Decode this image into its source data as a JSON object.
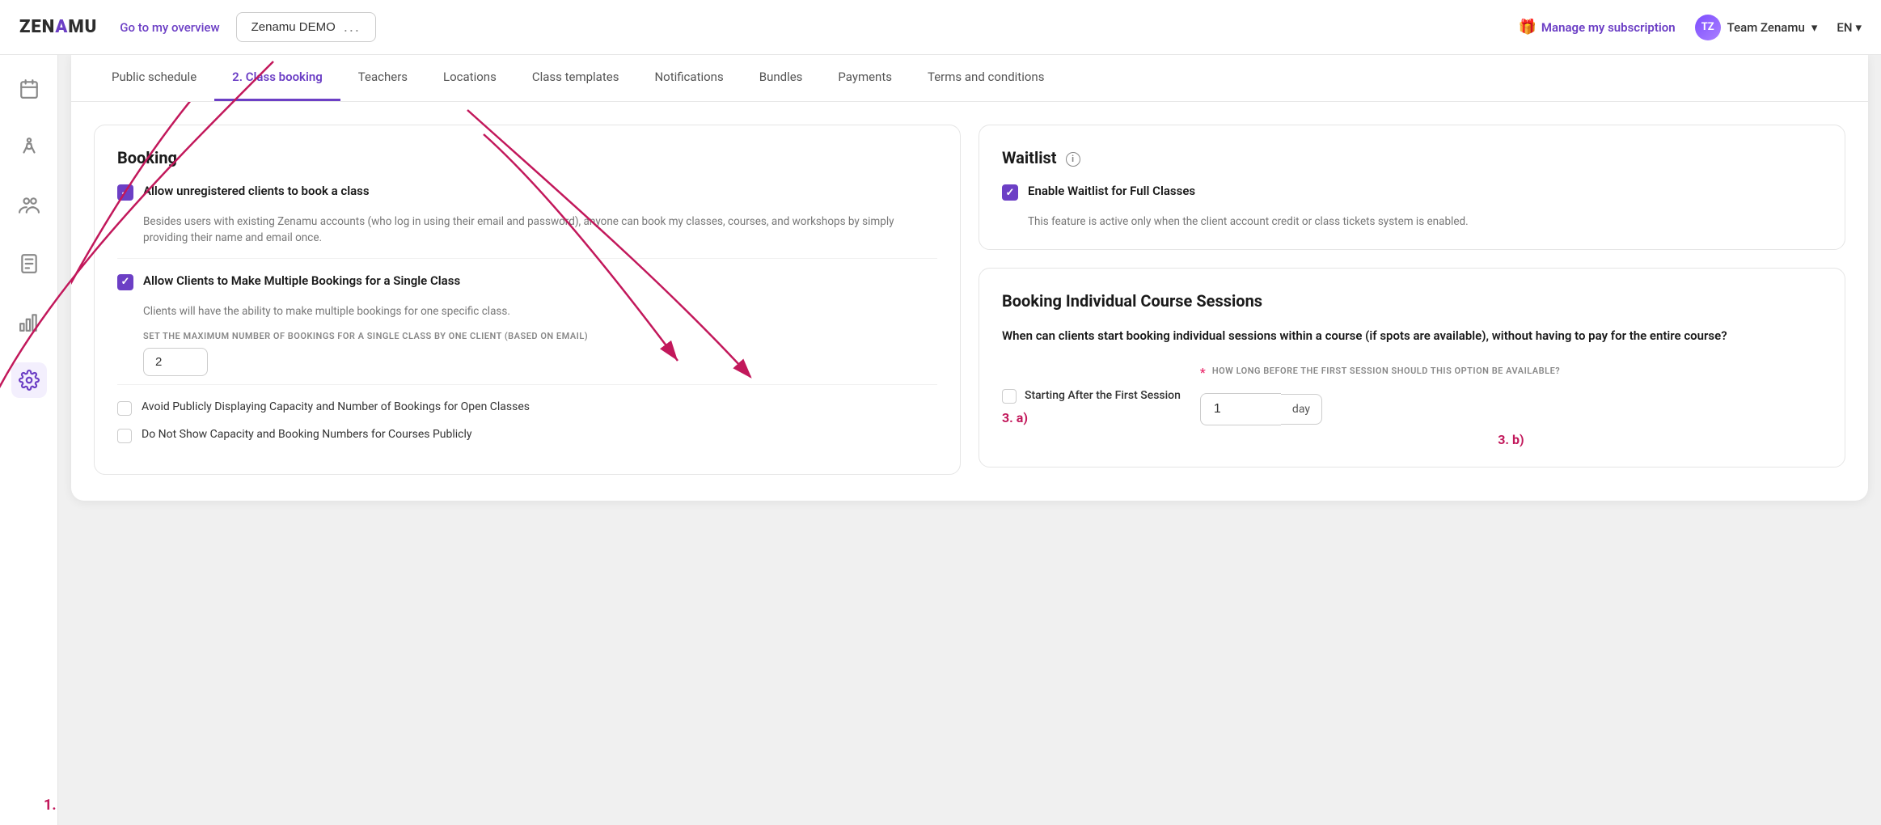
{
  "topbar": {
    "logo": "ZENAMU",
    "overview_link": "Go to my overview",
    "demo_btn_label": "Zenamu DEMO",
    "demo_btn_dots": "...",
    "subscription_link": "Manage my subscription",
    "user_name": "Team Zenamu",
    "lang": "EN"
  },
  "tabs": [
    {
      "id": "public-schedule",
      "label": "Public schedule",
      "active": false
    },
    {
      "id": "class-booking",
      "label": "2. Class booking",
      "active": true
    },
    {
      "id": "teachers",
      "label": "Teachers",
      "active": false
    },
    {
      "id": "locations",
      "label": "Locations",
      "active": false
    },
    {
      "id": "class-templates",
      "label": "Class templates",
      "active": false
    },
    {
      "id": "notifications",
      "label": "Notifications",
      "active": false
    },
    {
      "id": "bundles",
      "label": "Bundles",
      "active": false
    },
    {
      "id": "payments",
      "label": "Payments",
      "active": false
    },
    {
      "id": "terms-conditions",
      "label": "Terms and conditions",
      "active": false
    }
  ],
  "booking_card": {
    "title": "Booking",
    "checkbox1": {
      "label": "Allow unregistered clients to book a class",
      "checked": true,
      "description": "Besides users with existing Zenamu accounts (who log in using their email and password), anyone can book my classes, courses, and workshops by simply providing their name and email once."
    },
    "checkbox2": {
      "label": "Allow Clients to Make Multiple Bookings for a Single Class",
      "checked": true,
      "description": "Clients will have the ability to make multiple bookings for one specific class.",
      "sublabel": "SET THE MAXIMUM NUMBER OF BOOKINGS FOR A SINGLE CLASS BY ONE CLIENT (BASED ON EMAIL)",
      "value": "2"
    },
    "checkbox3": {
      "label": "Avoid Publicly Displaying Capacity and Number of Bookings for Open Classes",
      "checked": false
    },
    "checkbox4": {
      "label": "Do Not Show Capacity and Booking Numbers for Courses Publicly",
      "checked": false
    }
  },
  "waitlist_card": {
    "title": "Waitlist",
    "has_info": true,
    "checkbox1": {
      "label": "Enable Waitlist for Full Classes",
      "checked": true,
      "description": "This feature is active only when the client account credit or class tickets system is enabled."
    }
  },
  "booking_sessions_card": {
    "title": "Booking Individual Course Sessions",
    "description": "When can clients start booking individual sessions within a course (if spots are available), without having to pay for the entire course?",
    "session_checkbox": {
      "label": "Starting After the First Session",
      "checked": false
    },
    "right_label": "HOW LONG BEFORE THE FIRST SESSION SHOULD THIS OPTION BE AVAILABLE?",
    "day_value": "1",
    "day_unit": "day",
    "annotation_a": "3. a)",
    "annotation_b": "3. b)"
  },
  "sidebar": {
    "annotation_1": "1.",
    "icons": [
      {
        "id": "calendar-icon",
        "label": "calendar"
      },
      {
        "id": "yoga-icon",
        "label": "yoga/person"
      },
      {
        "id": "group-icon",
        "label": "group/people"
      },
      {
        "id": "list-icon",
        "label": "list/notes"
      },
      {
        "id": "chart-icon",
        "label": "chart/analytics"
      },
      {
        "id": "settings-icon",
        "label": "settings/gear",
        "active": true
      }
    ]
  },
  "colors": {
    "accent": "#6c3fc5",
    "pink": "#c2185b",
    "text_dark": "#1a1a1a",
    "text_mid": "#555",
    "text_light": "#777"
  }
}
